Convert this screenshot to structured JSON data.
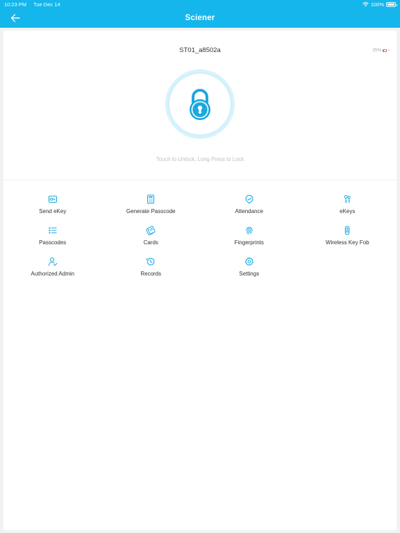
{
  "status_bar": {
    "time": "10:23 PM",
    "date": "Tue Dec 14",
    "battery": "100%"
  },
  "nav": {
    "title": "Sciener"
  },
  "lock": {
    "name": "ST01_a8502a",
    "battery_level": "25%",
    "hint": "Touch to Unlock, Long Press to Lock"
  },
  "menu": [
    {
      "label": "Send eKey",
      "icon": "send-ekey-icon"
    },
    {
      "label": "Generate Passcode",
      "icon": "generate-passcode-icon"
    },
    {
      "label": "Attendance",
      "icon": "attendance-icon"
    },
    {
      "label": "eKeys",
      "icon": "ekeys-icon"
    },
    {
      "label": "Passcodes",
      "icon": "passcodes-icon"
    },
    {
      "label": "Cards",
      "icon": "cards-icon"
    },
    {
      "label": "Fingerprints",
      "icon": "fingerprint-icon"
    },
    {
      "label": "Wireless Key Fob",
      "icon": "key-fob-icon"
    },
    {
      "label": "Authorized Admin",
      "icon": "authorized-admin-icon"
    },
    {
      "label": "Records",
      "icon": "records-icon"
    },
    {
      "label": "Settings",
      "icon": "settings-icon"
    }
  ],
  "colors": {
    "accent": "#14b6ec",
    "icon": "#1aa9de",
    "hint": "#b9c0c5"
  }
}
